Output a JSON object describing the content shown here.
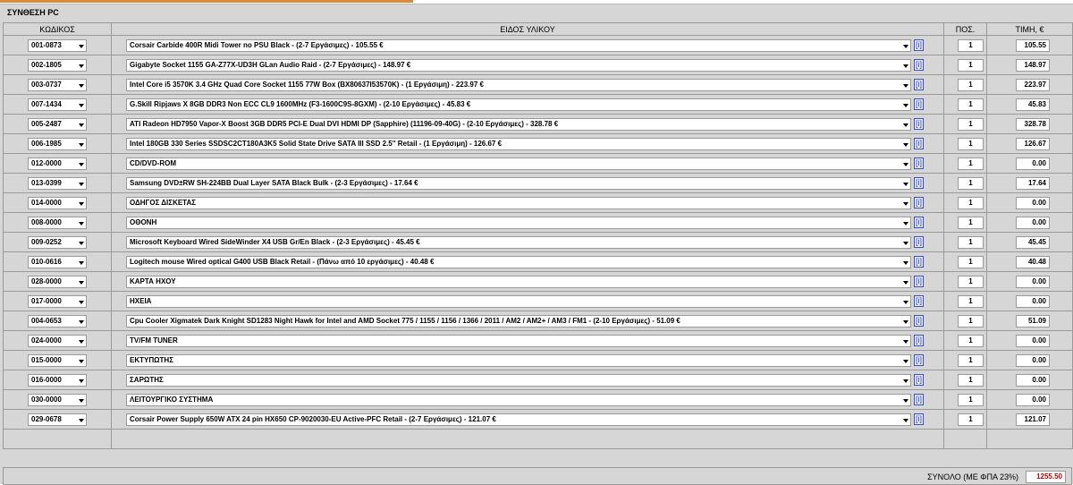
{
  "panel": {
    "title": "ΣΥΝΘΕΣΗ PC"
  },
  "headers": {
    "code": "ΚΩΔΙΚΟΣ",
    "item": "ΕΙΔΟΣ ΥΛΙΚΟΥ",
    "qty": "ΠΟΣ.",
    "price": "ΤΙΜΗ, €"
  },
  "info_label": "[i]",
  "rows": [
    {
      "code": "001-0873",
      "item": "Corsair Carbide 400R Midi Tower no PSU Black - (2-7 Εργάσιμες) - 105.55 €",
      "qty": "1",
      "price": "105.55"
    },
    {
      "code": "002-1805",
      "item": "Gigabyte Socket 1155 GA-Z77X-UD3H GLan Audio Raid - (2-7 Εργάσιμες) - 148.97 €",
      "qty": "1",
      "price": "148.97"
    },
    {
      "code": "003-0737",
      "item": "Intel Core i5 3570K 3.4 GHz Quad Core Socket 1155 77W Box (BX80637I53570K) - (1 Εργάσιμη) - 223.97 €",
      "qty": "1",
      "price": "223.97"
    },
    {
      "code": "007-1434",
      "item": "G.Skill Ripjaws X 8GB DDR3 Non ECC CL9 1600MHz (F3-1600C9S-8GXM) - (2-10 Εργάσιμες) - 45.83 €",
      "qty": "1",
      "price": "45.83"
    },
    {
      "code": "005-2487",
      "item": "ATI Radeon HD7950 Vapor-X Boost 3GB DDR5 PCI-E Dual DVI HDMI DP (Sapphire) (11196-09-40G) - (2-10 Εργάσιμες) - 328.78 €",
      "qty": "1",
      "price": "328.78"
    },
    {
      "code": "006-1985",
      "item": "Intel 180GB 330 Series SSDSC2CT180A3K5 Solid State Drive SATA III SSD 2.5'' Retail - (1 Εργάσιμη) - 126.67 €",
      "qty": "1",
      "price": "126.67"
    },
    {
      "code": "012-0000",
      "item": "CD/DVD-ROM",
      "qty": "1",
      "price": "0.00"
    },
    {
      "code": "013-0399",
      "item": "Samsung DVD±RW SH-224BB Dual Layer SATA Black Bulk - (2-3 Εργάσιμες) - 17.64 €",
      "qty": "1",
      "price": "17.64"
    },
    {
      "code": "014-0000",
      "item": "ΟΔΗΓΟΣ ΔΙΣΚΕΤΑΣ",
      "qty": "1",
      "price": "0.00"
    },
    {
      "code": "008-0000",
      "item": "ΟΘΟΝΗ",
      "qty": "1",
      "price": "0.00"
    },
    {
      "code": "009-0252",
      "item": "Microsoft Keyboard Wired SideWinder X4 USB Gr/En Black - (2-3 Εργάσιμες) - 45.45 €",
      "qty": "1",
      "price": "45.45"
    },
    {
      "code": "010-0616",
      "item": "Logitech mouse Wired optical G400 USB Black Retail - (Πάνω από 10 εργάσιμες) - 40.48 €",
      "qty": "1",
      "price": "40.48"
    },
    {
      "code": "028-0000",
      "item": "ΚΑΡΤΑ ΗΧΟΥ",
      "qty": "1",
      "price": "0.00"
    },
    {
      "code": "017-0000",
      "item": "ΗΧΕΙΑ",
      "qty": "1",
      "price": "0.00"
    },
    {
      "code": "004-0653",
      "item": "Cpu Cooler Xigmatek Dark Knight SD1283 Night Hawk for Intel and AMD Socket 775 / 1155 / 1156 / 1366 / 2011 / AM2 / AM2+ / AM3 / FM1 - (2-10 Εργάσιμες) - 51.09 €",
      "qty": "1",
      "price": "51.09"
    },
    {
      "code": "024-0000",
      "item": "TV/FM TUNER",
      "qty": "1",
      "price": "0.00"
    },
    {
      "code": "015-0000",
      "item": "ΕΚΤΥΠΩΤΗΣ",
      "qty": "1",
      "price": "0.00"
    },
    {
      "code": "016-0000",
      "item": "ΣΑΡΩΤΗΣ",
      "qty": "1",
      "price": "0.00"
    },
    {
      "code": "030-0000",
      "item": "ΛΕΙΤΟΥΡΓΙΚΟ ΣΥΣΤΗΜΑ",
      "qty": "1",
      "price": "0.00"
    },
    {
      "code": "029-0678",
      "item": "Corsair Power Supply 650W ATX 24 pin HX650 CP-9020030-EU Active-PFC Retail - (2-7 Εργάσιμες) - 121.07 €",
      "qty": "1",
      "price": "121.07"
    }
  ],
  "total": {
    "label": "ΣΥΝΟΛΟ (ΜΕ ΦΠΑ 23%)",
    "value": "1255.50"
  },
  "colors": {
    "total_value": "#c00000",
    "info_icon": "#2a3fb8",
    "panel_bg": "#d6d6d6"
  }
}
